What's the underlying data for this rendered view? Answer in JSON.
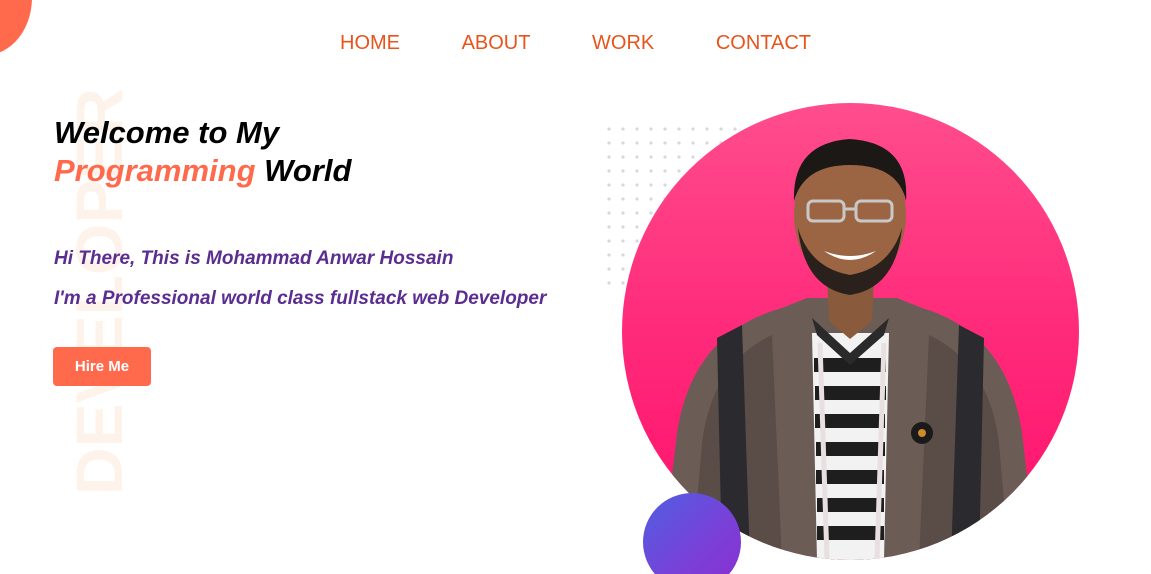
{
  "nav": {
    "items": [
      {
        "label": "HOME"
      },
      {
        "label": "ABOUT"
      },
      {
        "label": "WORK"
      },
      {
        "label": "CONTACT"
      }
    ]
  },
  "watermark": {
    "text": "DEVELOPER"
  },
  "hero": {
    "title_line1": "Welcome to My",
    "title_accent": "Programming",
    "title_rest": " World",
    "intro_line1": "Hi There, This is Mohammad Anwar Hossain",
    "intro_line2": "I'm a Professional world class fullstack web Developer",
    "hire_label": "Hire Me"
  },
  "colors": {
    "accent": "#ff6a4d",
    "nav_text": "#e8541c",
    "intro_text": "#5b2d90",
    "profile_circle": "#ff2a7a",
    "purple_ball": "#6a4fdc"
  },
  "icons": {
    "profile": "person-photo"
  }
}
